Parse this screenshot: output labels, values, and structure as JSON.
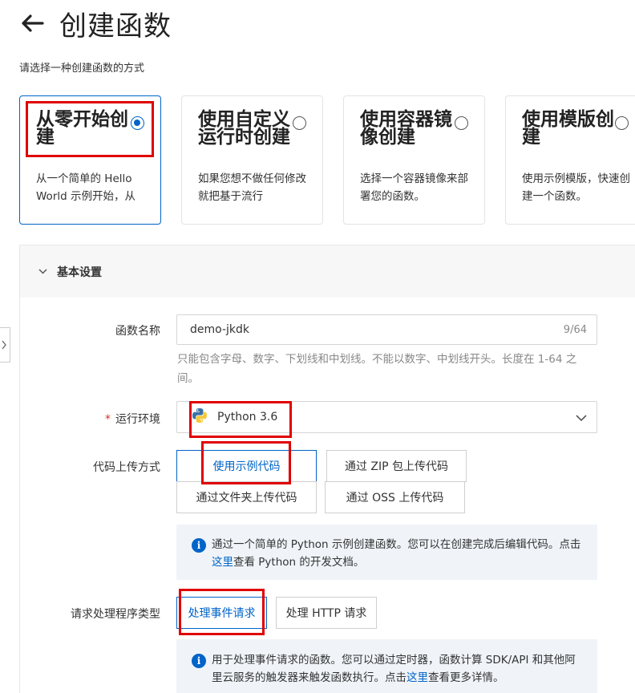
{
  "header": {
    "title": "创建函数",
    "back_icon": "arrow-left-icon"
  },
  "subtitle": "请选择一种创建函数的方式",
  "cards": [
    {
      "title": "从零开始创建",
      "desc": "从一个简单的 Hello World 示例开始，从",
      "selected": true
    },
    {
      "title": "使用自定义运行时创建",
      "desc": "如果您想不做任何修改就把基于流行",
      "selected": false
    },
    {
      "title": "使用容器镜像创建",
      "desc": "选择一个容器镜像来部署您的函数。",
      "selected": false
    },
    {
      "title": "使用模版创建",
      "desc": "使用示例模版，快速创建一个函数。",
      "selected": false
    }
  ],
  "section": {
    "title": "基本设置"
  },
  "form": {
    "func_name": {
      "label": "函数名称",
      "value": "demo-jkdk",
      "count": "9/64",
      "hint": "只能包含字母、数字、下划线和中划线。不能以数字、中划线开头。长度在 1-64 之间。"
    },
    "runtime": {
      "label": "运行环境",
      "required_mark": "*",
      "value": "Python 3.6",
      "icon": "python-icon"
    },
    "upload": {
      "label": "代码上传方式",
      "options": [
        "使用示例代码",
        "通过 ZIP 包上传代码",
        "通过文件夹上传代码",
        "通过 OSS 上传代码"
      ],
      "selected": "使用示例代码",
      "info_before": "通过一个简单的 Python 示例创建函数。您可以在创建完成后编辑代码。点击",
      "info_link": "这里",
      "info_after": "查看 Python 的开发文档。"
    },
    "handler": {
      "label": "请求处理程序类型",
      "options": [
        "处理事件请求",
        "处理 HTTP 请求"
      ],
      "selected": "处理事件请求",
      "info_before": "用于处理事件请求的函数。您可以通过定时器，函数计算 SDK/API 和其他阿里云服务的触发器来触发函数执行。点击",
      "info_link": "这里",
      "info_after": "查看更多详情。"
    }
  },
  "colors": {
    "accent": "#0064c8",
    "highlight_box": "#e00000",
    "info_bg": "#f0f4f9"
  }
}
